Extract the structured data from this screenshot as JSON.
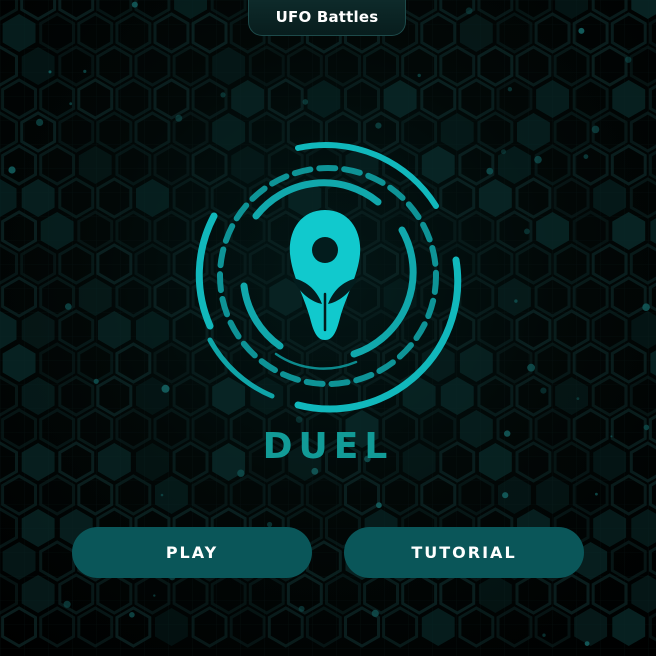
{
  "header": {
    "title": "UFO Battles"
  },
  "main": {
    "mode_label": "DUEL",
    "logo_icon": "alien-head-icon"
  },
  "buttons": {
    "play_label": "PLAY",
    "tutorial_label": "TUTORIAL"
  },
  "colors": {
    "accent": "#11c9cd",
    "accent_dark": "#0b8f93",
    "button_bg": "#0a5659",
    "label_color": "#129b97",
    "background": "#020606"
  }
}
